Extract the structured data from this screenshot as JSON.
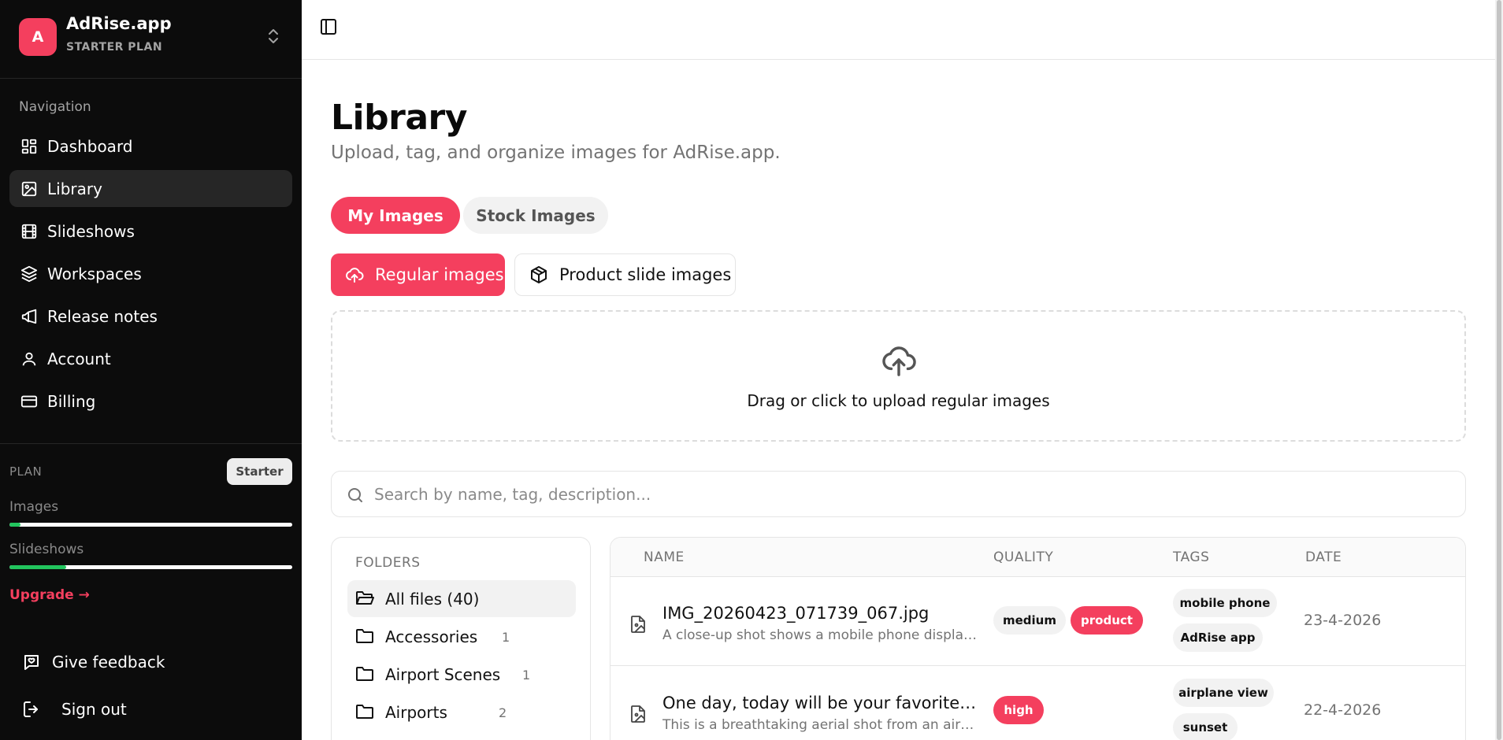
{
  "brand": {
    "initial": "A",
    "name": "AdRise.app",
    "plan": "STARTER PLAN"
  },
  "nav": {
    "heading": "Navigation",
    "items": [
      {
        "label": "Dashboard",
        "icon": "dashboard-icon"
      },
      {
        "label": "Library",
        "icon": "image-icon",
        "active": true
      },
      {
        "label": "Slideshows",
        "icon": "film-icon"
      },
      {
        "label": "Workspaces",
        "icon": "layers-icon"
      },
      {
        "label": "Release notes",
        "icon": "megaphone-icon"
      },
      {
        "label": "Account",
        "icon": "user-icon"
      },
      {
        "label": "Billing",
        "icon": "credit-card-icon"
      }
    ]
  },
  "plan": {
    "label": "PLAN",
    "badge": "Starter",
    "images_label": "Images",
    "images_usage": 0.04,
    "slideshows_label": "Slideshows",
    "slideshows_usage": 0.2,
    "upgrade": "Upgrade →"
  },
  "footer": {
    "feedback": "Give feedback",
    "signout": "Sign out"
  },
  "page": {
    "title": "Library",
    "subtitle": "Upload, tag, and organize images for AdRise.app."
  },
  "tabs": {
    "my_images": "My Images",
    "stock_images": "Stock Images"
  },
  "modes": {
    "regular": "Regular images",
    "product": "Product slide images"
  },
  "dropzone": {
    "text": "Drag or click to upload regular images"
  },
  "search": {
    "placeholder": "Search by name, tag, description..."
  },
  "folders": {
    "title": "FOLDERS",
    "items": [
      {
        "label": "All files (40)",
        "count": "",
        "active": true
      },
      {
        "label": "Accessories",
        "count": "1"
      },
      {
        "label": "Airport Scenes",
        "count": "1"
      },
      {
        "label": "Airports",
        "count": "2"
      }
    ]
  },
  "table": {
    "headers": {
      "name": "NAME",
      "quality": "QUALITY",
      "tags": "TAGS",
      "date": "DATE"
    },
    "rows": [
      {
        "name": "IMG_20260423_071739_067.jpg",
        "desc": "A close-up shot shows a mobile phone display…",
        "quality": [
          "medium",
          "product"
        ],
        "tags": [
          "mobile phone",
          "AdRise app"
        ],
        "date": "23-4-2026"
      },
      {
        "name": "One day, today will be your favorite sto…",
        "desc": "This is a breathtaking aerial shot from an airpla…",
        "quality": [
          "high"
        ],
        "tags": [
          "airplane view",
          "sunset"
        ],
        "date": "22-4-2026"
      }
    ]
  },
  "colors": {
    "accent": "#f43f5e",
    "sidebar_bg": "#0c0c0c",
    "meter_fill": "#22c55e"
  }
}
